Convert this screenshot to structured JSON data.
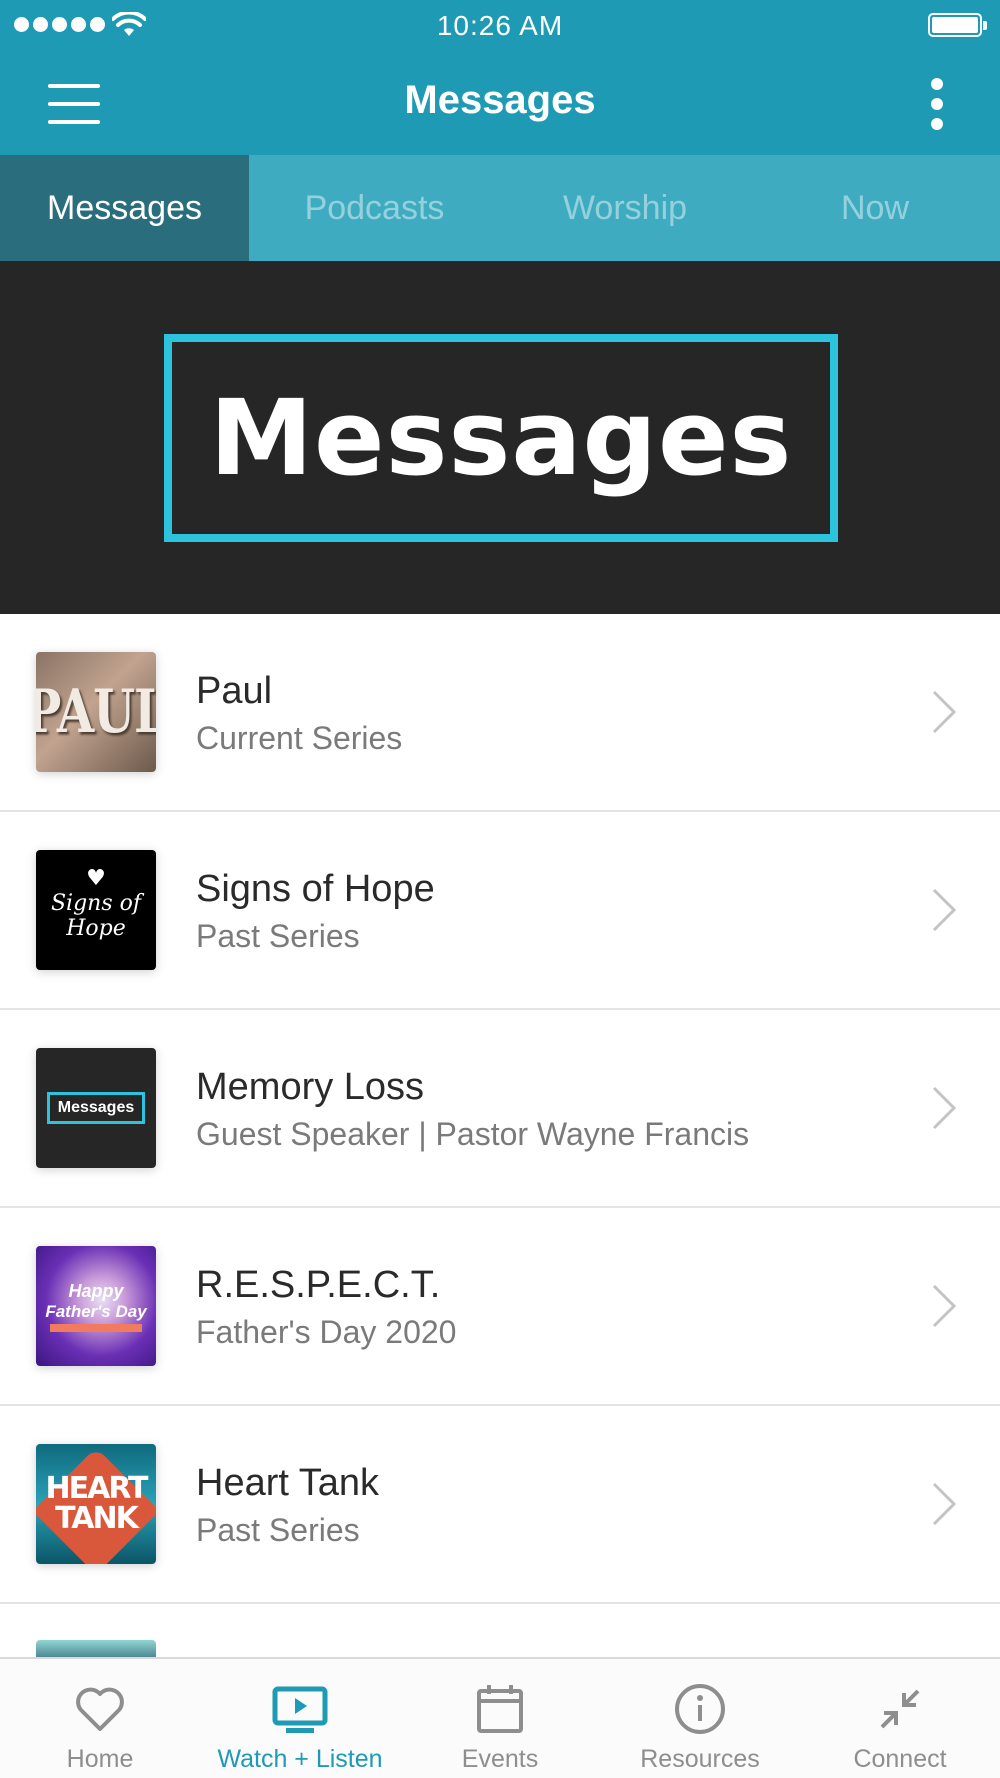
{
  "status_bar": {
    "time": "10:26 AM",
    "signal_bars": 5,
    "icons": [
      "signal-icon",
      "wifi-icon",
      "battery-icon"
    ]
  },
  "nav": {
    "title": "Messages",
    "menu_icon": "hamburger-menu-icon",
    "more_icon": "more-vertical-icon"
  },
  "tabs": [
    {
      "label": "Messages",
      "active": true
    },
    {
      "label": "Podcasts",
      "active": false
    },
    {
      "label": "Worship",
      "active": false
    },
    {
      "label": "Now",
      "active": false
    }
  ],
  "banner": {
    "text": "Messages"
  },
  "list": {
    "items": [
      {
        "title": "Paul",
        "subtitle": "Current Series",
        "thumb_text": "PAUL"
      },
      {
        "title": "Signs of Hope",
        "subtitle": "Past Series",
        "thumb_text_1": "Signs of",
        "thumb_text_2": "Hope"
      },
      {
        "title": "Memory Loss",
        "subtitle": "Guest Speaker | Pastor Wayne Francis",
        "thumb_text": "Messages"
      },
      {
        "title": "R.E.S.P.E.C.T.",
        "subtitle": "Father's Day 2020",
        "thumb_text_1": "Happy",
        "thumb_text_2": "Father's Day"
      },
      {
        "title": "Heart Tank",
        "subtitle": "Past Series",
        "thumb_text_1": "HEART",
        "thumb_text_2": "TANK"
      }
    ]
  },
  "tab_bar": {
    "items": [
      {
        "label": "Home",
        "icon": "heart-icon",
        "active": false
      },
      {
        "label": "Watch + Listen",
        "icon": "tv-play-icon",
        "active": true
      },
      {
        "label": "Events",
        "icon": "calendar-icon",
        "active": false
      },
      {
        "label": "Resources",
        "icon": "info-icon",
        "active": false
      },
      {
        "label": "Connect",
        "icon": "collapse-arrows-icon",
        "active": false
      }
    ]
  },
  "colors": {
    "brand_teal": "#1e9ab4",
    "tab_strip": "#3fabc1",
    "active_tab": "#2a6d7c",
    "banner_bg": "#262626",
    "banner_border": "#2ec3dd"
  }
}
